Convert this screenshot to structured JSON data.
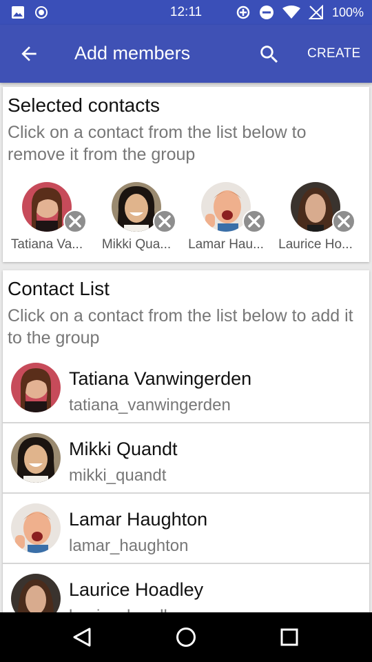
{
  "status_bar": {
    "time": "12:11",
    "battery": "100%",
    "icons_left": [
      "image-icon",
      "record-icon"
    ],
    "icons_right": [
      "data-saver-icon",
      "do-not-disturb-icon",
      "wifi-icon",
      "no-signal-icon",
      "battery-icon"
    ]
  },
  "app_bar": {
    "title": "Add members",
    "create_label": "CREATE",
    "color": "#3f51b5"
  },
  "selected": {
    "title": "Selected contacts",
    "subtitle": "Click on a contact from the list below to remove it from the group",
    "contacts": [
      {
        "name": "Tatiana Va..."
      },
      {
        "name": "Mikki Qua..."
      },
      {
        "name": "Lamar Hau..."
      },
      {
        "name": "Laurice Ho..."
      }
    ]
  },
  "contact_list": {
    "title": "Contact List",
    "subtitle": "Click on a contact from the list below to add it to the group",
    "contacts": [
      {
        "name": "Tatiana Vanwingerden",
        "handle": "tatiana_vanwingerden"
      },
      {
        "name": "Mikki Quandt",
        "handle": "mikki_quandt"
      },
      {
        "name": "Lamar Haughton",
        "handle": "lamar_haughton"
      },
      {
        "name": "Laurice Hoadley",
        "handle": "laurice_hoadley"
      }
    ]
  }
}
